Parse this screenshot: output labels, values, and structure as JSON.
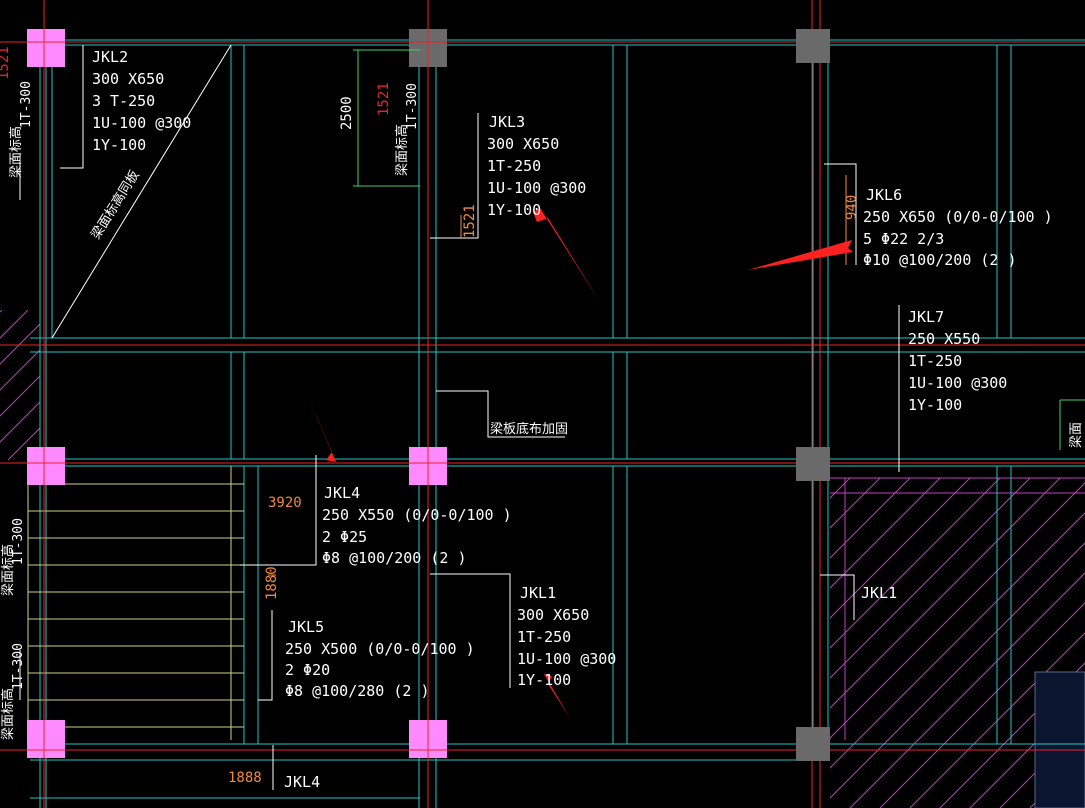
{
  "colors": {
    "background": "#000000",
    "axis_red": "#e8242a",
    "beam_cyan": "#23c5c5",
    "column_pink": "#ff8aff",
    "column_gray": "#6a6a6a",
    "dim_orange": "#f08a3a",
    "dim_green": "#3fd06a",
    "hatch_magenta": "#c23ec2",
    "text_white": "#ffffff",
    "arrow_red": "#ff2020",
    "stair_yellow": "#d0d08a"
  },
  "beams": {
    "jkl2": {
      "lines": [
        "JKL2",
        "300 X650",
        "3 T-250",
        "1U-100 @300",
        "1Y-100"
      ]
    },
    "jkl3": {
      "lines": [
        "JKL3",
        "300 X650",
        "1T-250",
        "1U-100 @300",
        "1Y-100"
      ]
    },
    "jkl6": {
      "lines": [
        "JKL6",
        "250 X650 (0/0-0/100 )",
        "5 Φ22  2/3",
        "Φ10 @100/200 (2 )"
      ]
    },
    "jkl7": {
      "lines": [
        "JKL7",
        "250 X550",
        "1T-250",
        "1U-100 @300",
        "1Y-100"
      ]
    },
    "jkl4": {
      "lines": [
        "JKL4",
        "250 X550 (0/0-0/100 )",
        "2 Φ25",
        "Φ8 @100/200 (2 )"
      ]
    },
    "jkl1": {
      "lines": [
        "JKL1",
        "300 X650",
        "1T-250",
        "1U-100 @300",
        "1Y-100"
      ]
    },
    "jkl5": {
      "lines": [
        "JKL5",
        "250 X500 (0/0-0/100 )",
        "2 Φ20",
        "Φ8 @100/280 (2 )"
      ]
    },
    "jkl1_right": {
      "label": "JKL1"
    },
    "jkl4_bottom": {
      "label": "JKL4"
    }
  },
  "dimensions": {
    "d2500": "2500",
    "d1521_top": "1521",
    "d1521_mid": "1521",
    "d3920": "3920",
    "d1880_v": "1880",
    "d1888": "1888",
    "d940": "940",
    "d1521_left": "1521"
  },
  "side_labels": {
    "left_top": "1T-300",
    "left_mid": "1T-300",
    "left_bot": "1T-300",
    "mid_top": "1T-300",
    "note_edge_1": "梁面标高",
    "note_edge_2": "梁面标高",
    "note_edge_3": "梁面标高",
    "note_edge_4": "梁面标高",
    "note_right": "梁面",
    "diag_note": "梁面标高同板",
    "mid_note": "梁板底布加固"
  }
}
